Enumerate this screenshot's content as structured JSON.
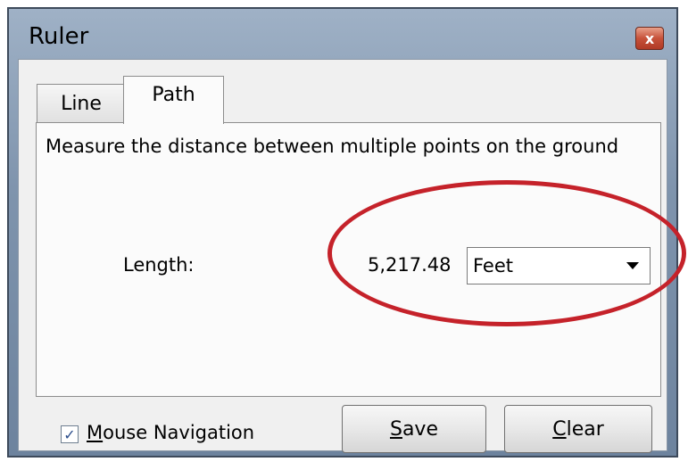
{
  "window": {
    "title": "Ruler",
    "close_glyph": "x"
  },
  "tabs": [
    {
      "label": "Line",
      "selected": false
    },
    {
      "label": "Path",
      "selected": true
    }
  ],
  "panel": {
    "description": "Measure the distance between multiple points on the ground",
    "length_label": "Length:",
    "length_value": "5,217.48",
    "unit_select": {
      "selected": "Feet"
    }
  },
  "footer": {
    "mouse_navigation": {
      "checked": true,
      "mnemonic": "M",
      "label_rest": "ouse Navigation"
    },
    "save_button": {
      "mnemonic": "S",
      "label_rest": "ave"
    },
    "clear_button": {
      "mnemonic": "C",
      "label_rest": "lear"
    }
  },
  "colors": {
    "highlight_ellipse": "#c5222a",
    "title_bar": "#8da1b8",
    "close_button": "#c7523a"
  }
}
